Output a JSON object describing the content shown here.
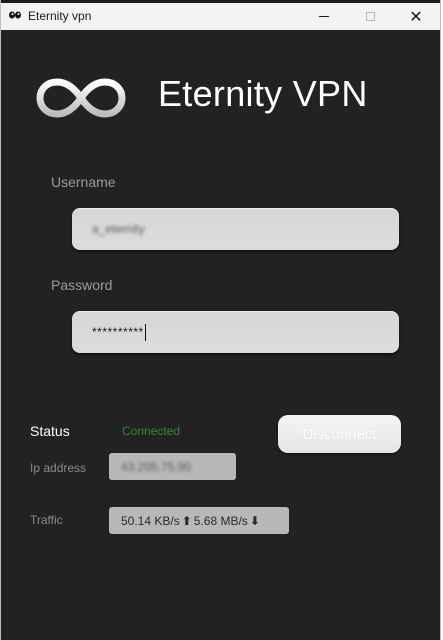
{
  "window": {
    "title": "Eternity vpn",
    "title_icon": "app-eyes-icon",
    "controls": {
      "minimize": "minimize-icon",
      "maximize": "maximize-icon",
      "close_glyph": "✕"
    }
  },
  "app": {
    "name": "Eternity VPN",
    "logo": "infinity-icon"
  },
  "login": {
    "username_label": "Username",
    "username_value": "a_eternity",
    "password_label": "Password",
    "password_value": "**********"
  },
  "status": {
    "label": "Status",
    "value": "Connected",
    "value_color": "#2c8c2c",
    "action_button": "Disconnect"
  },
  "ip": {
    "label": "Ip address",
    "value": "43.205.75.90"
  },
  "traffic": {
    "label": "Traffic",
    "up": "50.14 KB/s",
    "up_arrow": "⬆",
    "down": "5.68 MB/s",
    "down_arrow": "⬇"
  }
}
